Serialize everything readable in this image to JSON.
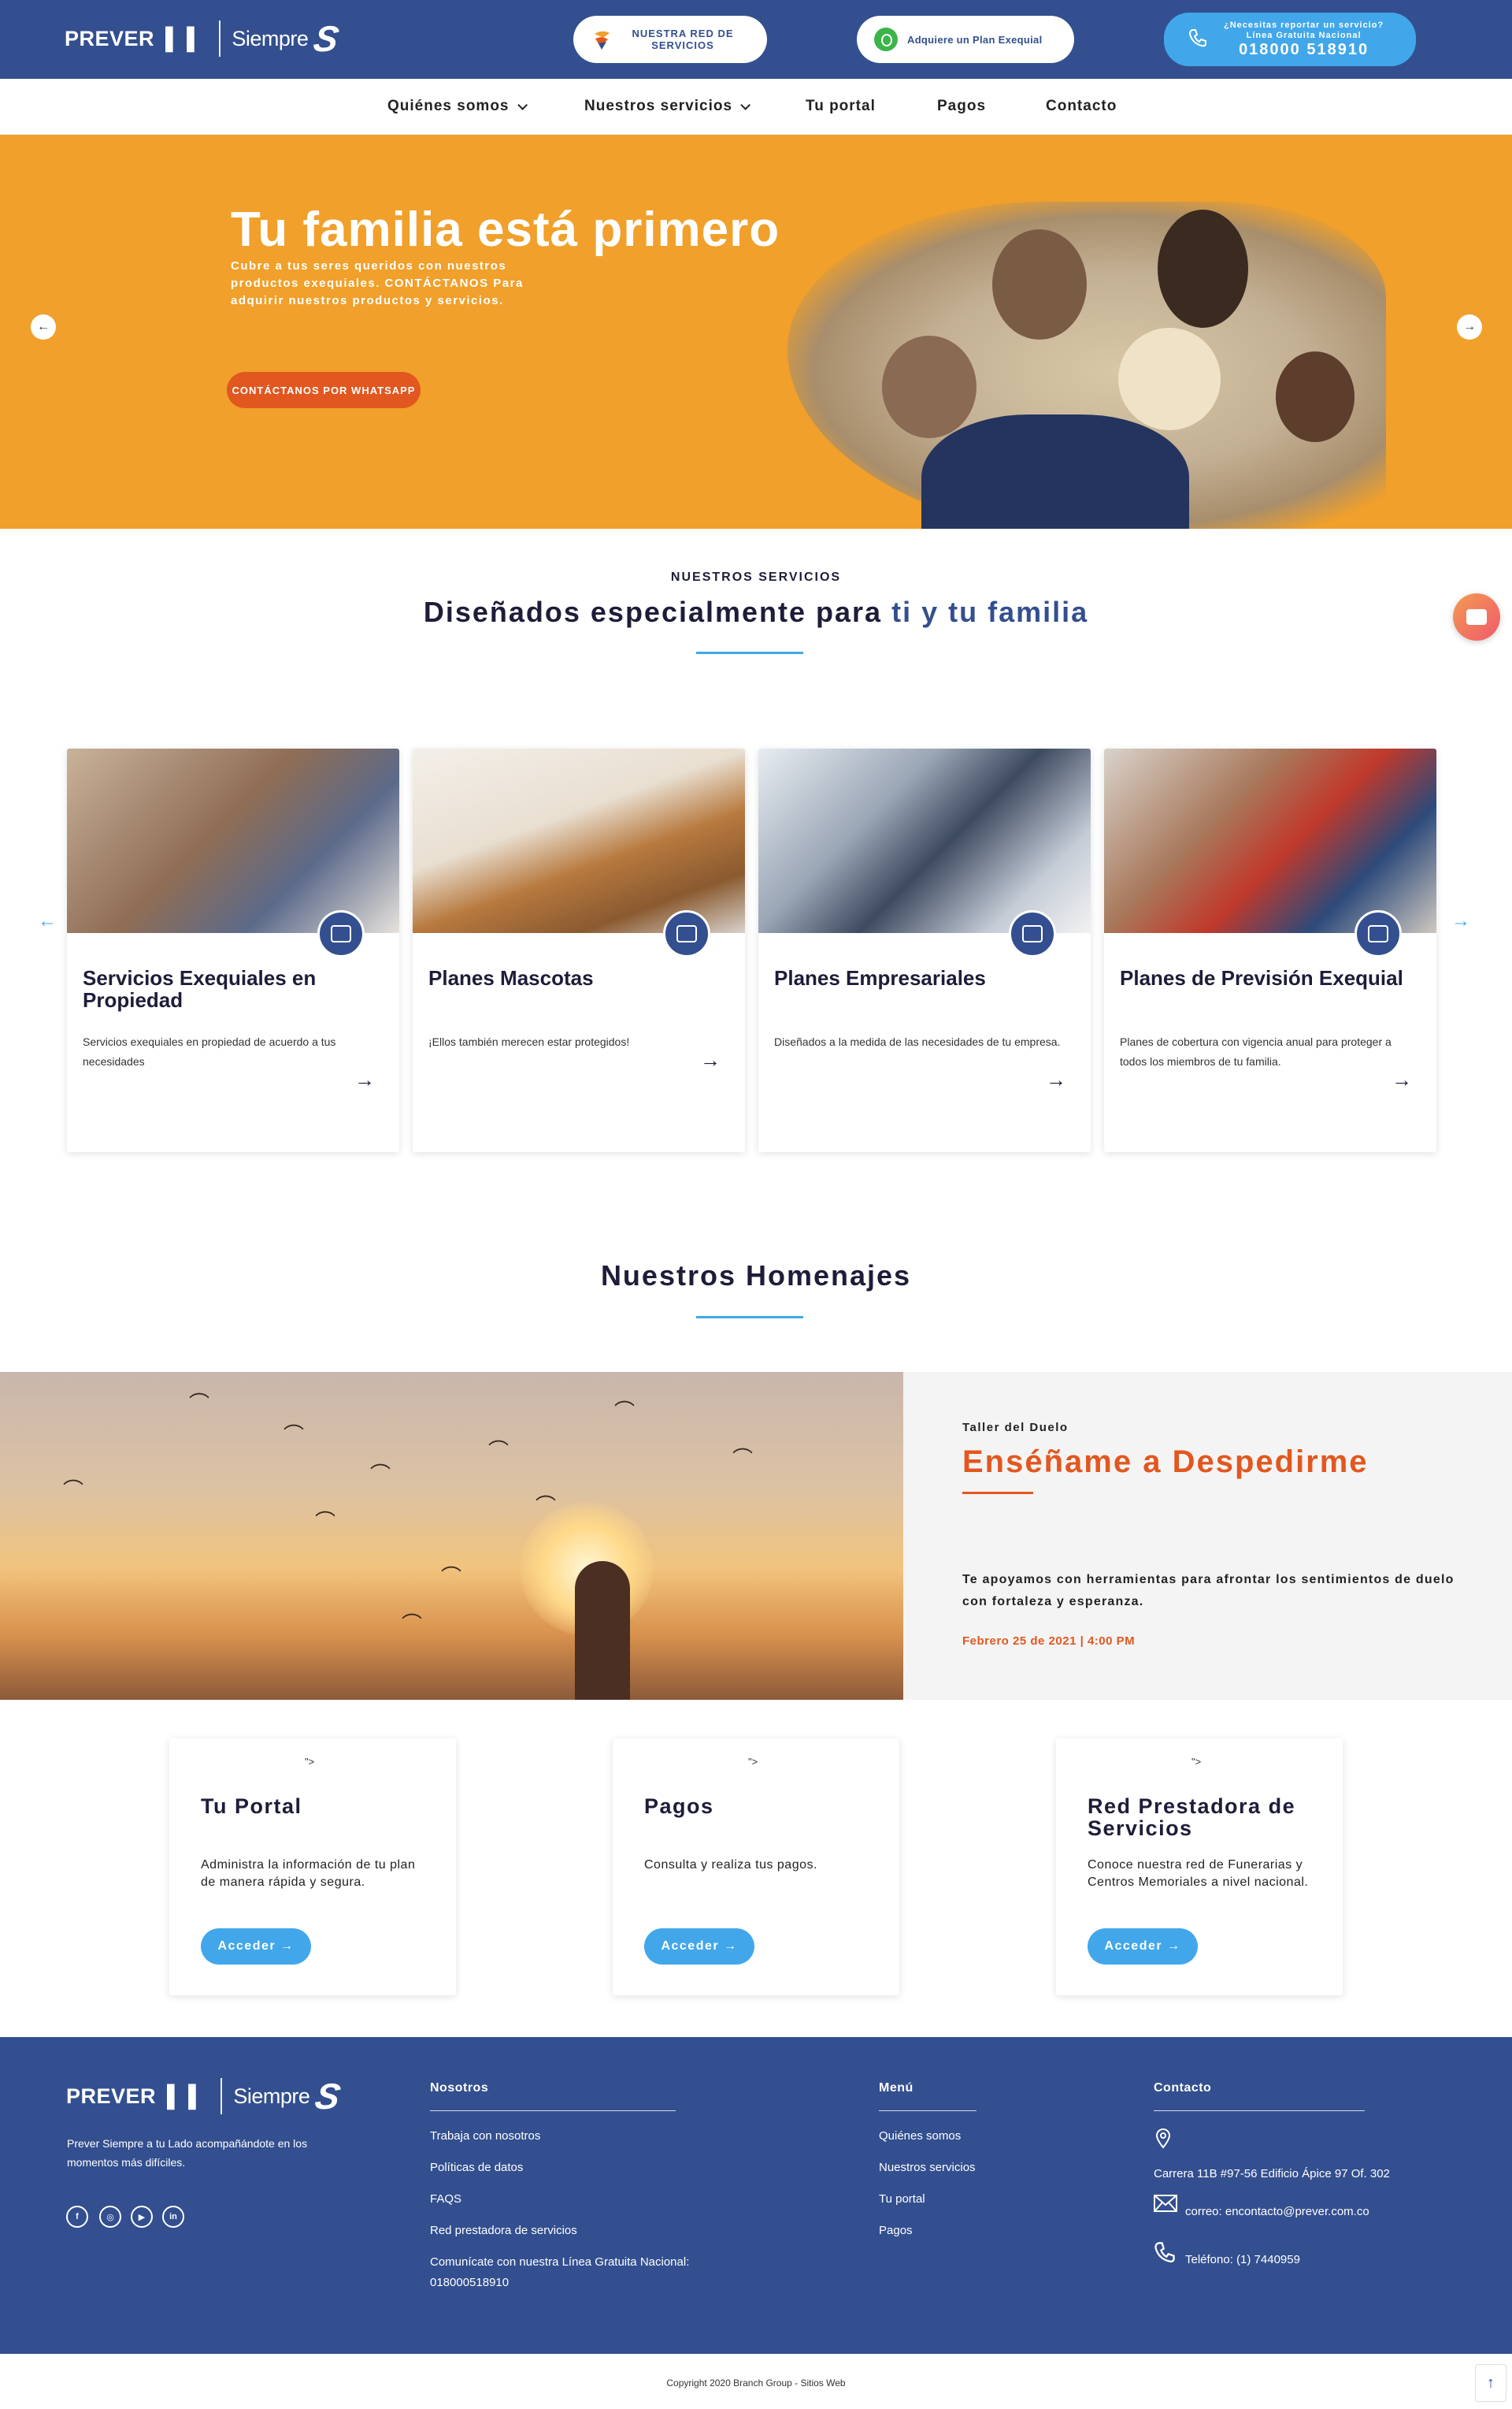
{
  "brand": {
    "prever": "PREVER",
    "bars": "▌▌",
    "siempre": "Siempre"
  },
  "header": {
    "red_servicios": "NUESTRA RED DE SERVICIOS",
    "whatsapp_plan": "Adquiere un Plan Exequial",
    "report_line1": "¿Necesitas reportar un servicio?",
    "report_line2": "Línea Gratuita Nacional",
    "phone": "018000 518910"
  },
  "nav": [
    "Quiénes somos",
    "Nuestros servicios",
    "Tu portal",
    "Pagos",
    "Contacto"
  ],
  "hero": {
    "title": "Tu familia está primero",
    "subtitle": "Cubre a tus seres queridos con nuestros productos exequiales. CONTÁCTANOS Para adquirir nuestros productos y servicios.",
    "cta": "CONTÁCTANOS POR WHATSAPP",
    "prev_arrow": "←",
    "next_arrow": "→"
  },
  "services": {
    "eyebrow": "NUESTROS SERVICIOS",
    "title_main": "Diseñados especialmente para ",
    "title_accent": "ti y tu familia",
    "arrow": "→",
    "side_left": "←",
    "side_right": "→",
    "cards": [
      {
        "title": "Servicios Exequiales en Propiedad",
        "desc": "Servicios exequiales en propiedad de acuerdo a tus necesidades"
      },
      {
        "title": "Planes Mascotas",
        "desc": "¡Ellos también merecen estar protegidos!"
      },
      {
        "title": "Planes Empresariales",
        "desc": "Diseñados a la medida de las necesidades de tu empresa."
      },
      {
        "title": "Planes de Previsión Exequial",
        "desc": "Planes de cobertura con vigencia anual para proteger a todos los miembros de tu familia."
      }
    ]
  },
  "homenajes": {
    "title": "Nuestros Homenajes",
    "eyebrow": "Taller del Duelo",
    "headline": "Enséñame a Despedirme",
    "desc": "Te apoyamos con herramientas para afrontar los sentimientos de duelo con fortaleza y esperanza.",
    "date": "Febrero 25 de 2021 | 4:00 PM"
  },
  "quick": {
    "symbol": "\">",
    "button": "Acceder →",
    "cards": [
      {
        "title": "Tu Portal",
        "desc": "Administra la información de tu plan de manera rápida y segura."
      },
      {
        "title": "Pagos",
        "desc": "Consulta y realiza tus pagos."
      },
      {
        "title": "Red Prestadora de Servicios",
        "desc": "Conoce nuestra red de Funerarias y Centros Memoriales a nivel nacional."
      }
    ]
  },
  "footer": {
    "tagline": "Prever Siempre a tu Lado acompañándote en los momentos más difíciles.",
    "social": [
      "f",
      "◎",
      "▶",
      "in"
    ],
    "nosotros_head": "Nosotros",
    "nosotros": [
      "Trabaja con nosotros",
      "Políticas de datos",
      "FAQS",
      "Red prestadora de servicios",
      "Comunícate con nuestra Línea Gratuita Nacional: 018000518910"
    ],
    "menu_head": "Menú",
    "menu": [
      "Quiénes somos",
      "Nuestros servicios",
      "Tu portal",
      "Pagos"
    ],
    "contacto_head": "Contacto",
    "address": "Carrera 11B #97-56 Edificio Ápice 97 Of. 302",
    "email": "correo: encontacto@prever.com.co",
    "phone": "Teléfono: (1) 7440959",
    "copyright": "Copyright 2020 Branch Group - Sitios Web",
    "to_top": "↑"
  },
  "colors": {
    "brand_blue": "#334f8f",
    "accent_orange": "#f0a02b",
    "cta_orange": "#e2571f",
    "light_blue": "#42a7ea"
  }
}
